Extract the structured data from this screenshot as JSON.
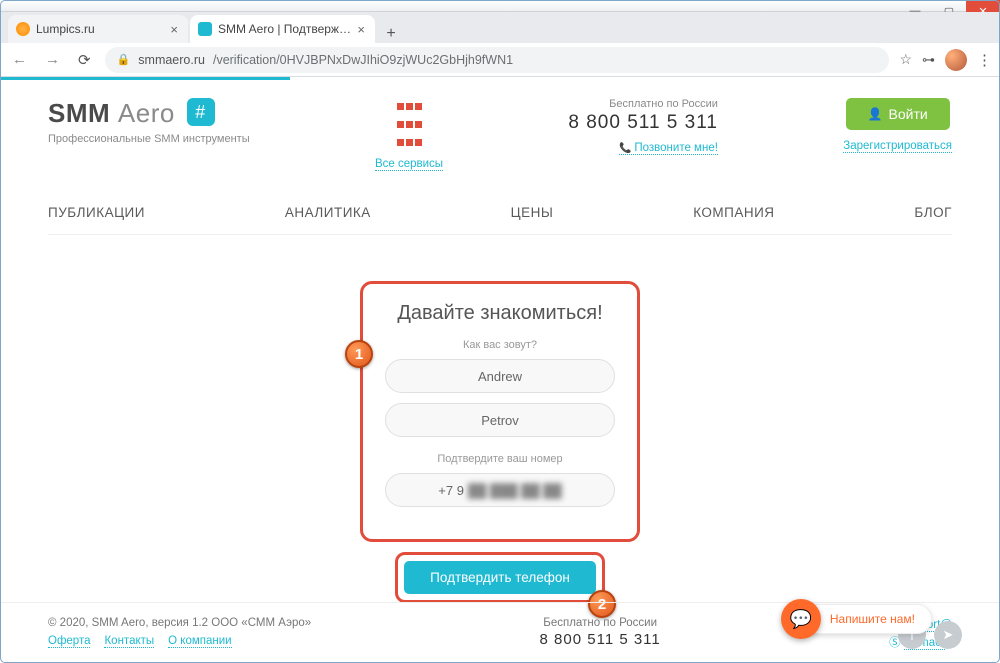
{
  "browser": {
    "tabs": [
      {
        "title": "Lumpics.ru"
      },
      {
        "title": "SMM Aero | Подтверждение да"
      }
    ],
    "url_host": "smmaero.ru",
    "url_path": "/verification/0HVJBPNxDwJIhiO9zjWUc2GbHjh9fWN1"
  },
  "header": {
    "logo_smm": "SMM",
    "logo_aero": "Aero",
    "hash": "#",
    "tagline": "Профессиональные SMM инструменты",
    "all_services": "Все сервисы",
    "free_label": "Бесплатно по России",
    "phone": "8 800 511 5 311",
    "call_me": "Позвоните мне!",
    "login": "Войти",
    "register": "Зарегистрироваться"
  },
  "nav": {
    "i0": "ПУБЛИКАЦИИ",
    "i1": "АНАЛИТИКА",
    "i2": "ЦЕНЫ",
    "i3": "КОМПАНИЯ",
    "i4": "БЛОГ"
  },
  "form": {
    "title": "Давайте знакомиться!",
    "name_label": "Как вас зовут?",
    "first_name": "Andrew",
    "last_name": "Petrov",
    "phone_label": "Подтвердите ваш номер",
    "phone_prefix": "+7 9",
    "phone_masked": "██  ███  ██  ██",
    "confirm": "Подтвердить телефон",
    "marker1": "1",
    "marker2": "2"
  },
  "footer": {
    "copyright": "© 2020, SMM Aero, версия 1.2 ООО «СММ Аэро»",
    "oferta": "Оферта",
    "contacts": "Контакты",
    "about": "О компании",
    "free_label": "Бесплатно по России",
    "phone": "8 800 511 5 311",
    "support_email": "support@",
    "skype": "smmaer"
  },
  "chat": {
    "label": "Напишите нам!"
  }
}
